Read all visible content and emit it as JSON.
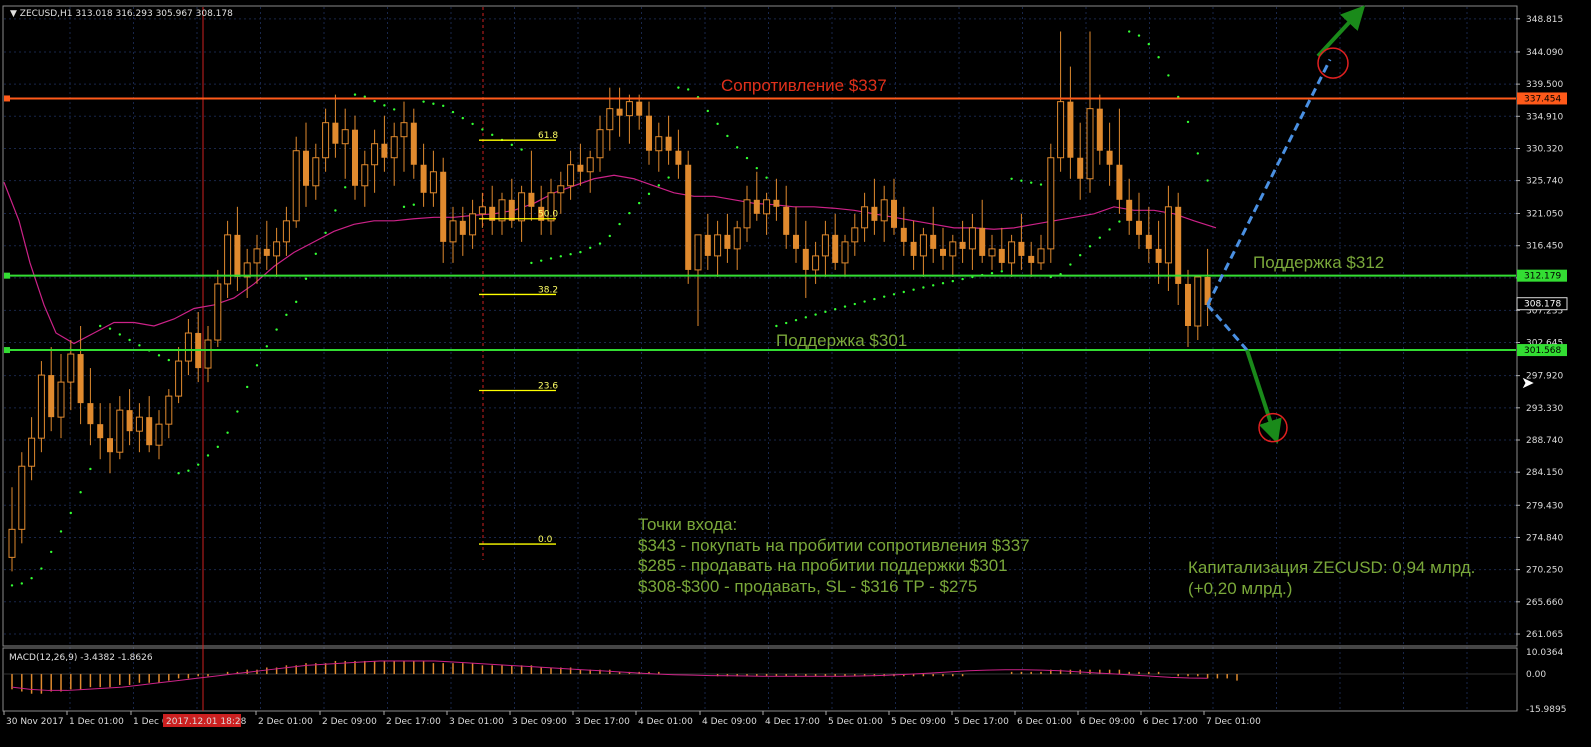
{
  "header": {
    "symbol": "ZECUSD,H1",
    "ohlc": "313.018 316.293 305.967 308.178",
    "macd_label": "MACD(12,26,9) -3.4382 -1.8626"
  },
  "colors": {
    "background": "#000000",
    "grid": "#18264a",
    "frame": "#8a8a8a",
    "candle": "#e08a2e",
    "resistance": "#ff5a1a",
    "support": "#33dd33",
    "ma": "#cc2288",
    "psar": "#33ff33",
    "fib": "#ffff00",
    "arrow_dash": "#4a90e2",
    "arrow_green": "#1a8a1a",
    "target_circle": "#e02020",
    "text_green": "#7aa83a",
    "text_red": "#e0301a"
  },
  "annotations": {
    "resistance_label": "Сопротивление $337",
    "support_312_label": "Поддержка $312",
    "support_301_label": "Поддержка $301",
    "entry_title": "Точки входа:",
    "entry_lines": [
      "$343 - покупать на пробитии сопротивления $337",
      "$285 - продавать на пробитии поддержки $301",
      "$308-$300  - продавать, SL - $316 TP - $275"
    ],
    "cap_line1": "Капитализация ZECUSD: 0,94 млрд.",
    "cap_line2": "(+0,20 млрд.)"
  },
  "chart_data": {
    "type": "candlestick",
    "symbol": "ZECUSD",
    "timeframe": "H1",
    "ylim": [
      259.5,
      350.5
    ],
    "y_ticks": [
      348.815,
      344.09,
      339.5,
      334.91,
      330.32,
      325.74,
      321.05,
      316.45,
      311.86,
      307.235,
      302.645,
      297.92,
      293.33,
      288.74,
      284.15,
      279.43,
      274.84,
      270.25,
      265.66,
      261.065
    ],
    "price_flags": [
      {
        "label": "337.454",
        "value": 337.454,
        "color": "#ff5a1a"
      },
      {
        "label": "312.179",
        "value": 312.179,
        "color": "#33dd33"
      },
      {
        "label": "308.178",
        "value": 308.178,
        "color": "#000000"
      },
      {
        "label": "301.568",
        "value": 301.568,
        "color": "#33dd33"
      }
    ],
    "x_labels": [
      "30 Nov 2017",
      "1 Dec 01:00",
      "1 Dec 0",
      "2017.12.01 18:28",
      "2 Dec 01:00",
      "2 Dec 09:00",
      "2 Dec 17:00",
      "3 Dec 01:00",
      "3 Dec 09:00",
      "3 Dec 17:00",
      "4 Dec 01:00",
      "4 Dec 09:00",
      "4 Dec 17:00",
      "5 Dec 01:00",
      "5 Dec 09:00",
      "5 Dec 17:00",
      "6 Dec 01:00",
      "6 Dec 09:00",
      "6 Dec 17:00",
      "7 Dec 01:00"
    ],
    "horizontal_levels": [
      {
        "name": "resistance",
        "value": 337.454
      },
      {
        "name": "support_312",
        "value": 312.179
      },
      {
        "name": "support_301",
        "value": 301.568
      }
    ],
    "fib_levels": [
      {
        "label": "61.8",
        "value": 331.5
      },
      {
        "label": "50.0",
        "value": 320.3
      },
      {
        "label": "38.2",
        "value": 309.5
      },
      {
        "label": "23.6",
        "value": 295.8
      },
      {
        "label": "0.0",
        "value": 273.9
      }
    ],
    "candles": [
      {
        "o": 272,
        "h": 282,
        "l": 270,
        "c": 276
      },
      {
        "o": 276,
        "h": 287,
        "l": 274,
        "c": 285
      },
      {
        "o": 285,
        "h": 292,
        "l": 283,
        "c": 289
      },
      {
        "o": 289,
        "h": 300,
        "l": 287,
        "c": 298
      },
      {
        "o": 298,
        "h": 302,
        "l": 290,
        "c": 292
      },
      {
        "o": 292,
        "h": 301,
        "l": 289,
        "c": 297
      },
      {
        "o": 297,
        "h": 303,
        "l": 293,
        "c": 301
      },
      {
        "o": 301,
        "h": 305,
        "l": 291,
        "c": 294
      },
      {
        "o": 294,
        "h": 299,
        "l": 288,
        "c": 291
      },
      {
        "o": 291,
        "h": 294,
        "l": 286,
        "c": 289
      },
      {
        "o": 289,
        "h": 294,
        "l": 284,
        "c": 287
      },
      {
        "o": 287,
        "h": 295,
        "l": 286,
        "c": 293
      },
      {
        "o": 293,
        "h": 296,
        "l": 288,
        "c": 290
      },
      {
        "o": 290,
        "h": 294,
        "l": 287,
        "c": 292
      },
      {
        "o": 292,
        "h": 295,
        "l": 287,
        "c": 288
      },
      {
        "o": 288,
        "h": 293,
        "l": 286,
        "c": 291
      },
      {
        "o": 291,
        "h": 296,
        "l": 289,
        "c": 295
      },
      {
        "o": 295,
        "h": 302,
        "l": 294,
        "c": 300
      },
      {
        "o": 300,
        "h": 306,
        "l": 298,
        "c": 304
      },
      {
        "o": 304,
        "h": 307,
        "l": 297,
        "c": 299
      },
      {
        "o": 299,
        "h": 305,
        "l": 297,
        "c": 303
      },
      {
        "o": 303,
        "h": 313,
        "l": 302,
        "c": 311
      },
      {
        "o": 311,
        "h": 320,
        "l": 309,
        "c": 318
      },
      {
        "o": 318,
        "h": 322,
        "l": 310,
        "c": 312
      },
      {
        "o": 312,
        "h": 316,
        "l": 309,
        "c": 314
      },
      {
        "o": 314,
        "h": 318,
        "l": 311,
        "c": 316
      },
      {
        "o": 316,
        "h": 320,
        "l": 313,
        "c": 315
      },
      {
        "o": 315,
        "h": 319,
        "l": 312,
        "c": 317
      },
      {
        "o": 317,
        "h": 322,
        "l": 315,
        "c": 320
      },
      {
        "o": 320,
        "h": 332,
        "l": 319,
        "c": 330
      },
      {
        "o": 330,
        "h": 334,
        "l": 322,
        "c": 325
      },
      {
        "o": 325,
        "h": 331,
        "l": 323,
        "c": 329
      },
      {
        "o": 329,
        "h": 336,
        "l": 327,
        "c": 334
      },
      {
        "o": 334,
        "h": 338,
        "l": 329,
        "c": 331
      },
      {
        "o": 331,
        "h": 336,
        "l": 326,
        "c": 333
      },
      {
        "o": 333,
        "h": 335,
        "l": 323,
        "c": 325
      },
      {
        "o": 325,
        "h": 330,
        "l": 322,
        "c": 328
      },
      {
        "o": 328,
        "h": 333,
        "l": 324,
        "c": 331
      },
      {
        "o": 331,
        "h": 335,
        "l": 327,
        "c": 329
      },
      {
        "o": 329,
        "h": 334,
        "l": 325,
        "c": 332
      },
      {
        "o": 332,
        "h": 337,
        "l": 327,
        "c": 334
      },
      {
        "o": 334,
        "h": 336,
        "l": 326,
        "c": 328
      },
      {
        "o": 328,
        "h": 331,
        "l": 322,
        "c": 324
      },
      {
        "o": 324,
        "h": 330,
        "l": 322,
        "c": 327
      },
      {
        "o": 327,
        "h": 329,
        "l": 314,
        "c": 317
      },
      {
        "o": 317,
        "h": 322,
        "l": 314,
        "c": 320
      },
      {
        "o": 320,
        "h": 322,
        "l": 315,
        "c": 318
      },
      {
        "o": 318,
        "h": 323,
        "l": 316,
        "c": 321
      },
      {
        "o": 321,
        "h": 324,
        "l": 319,
        "c": 322
      },
      {
        "o": 322,
        "h": 325,
        "l": 318,
        "c": 320
      },
      {
        "o": 320,
        "h": 324,
        "l": 318,
        "c": 323
      },
      {
        "o": 323,
        "h": 326,
        "l": 319,
        "c": 320
      },
      {
        "o": 320,
        "h": 325,
        "l": 317,
        "c": 324
      },
      {
        "o": 324,
        "h": 330,
        "l": 320,
        "c": 322
      },
      {
        "o": 322,
        "h": 325,
        "l": 318,
        "c": 320
      },
      {
        "o": 320,
        "h": 326,
        "l": 318,
        "c": 324
      },
      {
        "o": 324,
        "h": 327,
        "l": 321,
        "c": 325
      },
      {
        "o": 325,
        "h": 330,
        "l": 323,
        "c": 328
      },
      {
        "o": 328,
        "h": 331,
        "l": 325,
        "c": 327
      },
      {
        "o": 327,
        "h": 330,
        "l": 324,
        "c": 329
      },
      {
        "o": 329,
        "h": 335,
        "l": 327,
        "c": 333
      },
      {
        "o": 333,
        "h": 339,
        "l": 330,
        "c": 336
      },
      {
        "o": 336,
        "h": 339,
        "l": 332,
        "c": 335
      },
      {
        "o": 335,
        "h": 338,
        "l": 331,
        "c": 337
      },
      {
        "o": 337,
        "h": 338,
        "l": 333,
        "c": 335
      },
      {
        "o": 335,
        "h": 337,
        "l": 328,
        "c": 330
      },
      {
        "o": 330,
        "h": 334,
        "l": 327,
        "c": 332
      },
      {
        "o": 332,
        "h": 335,
        "l": 328,
        "c": 330
      },
      {
        "o": 330,
        "h": 333,
        "l": 326,
        "c": 328
      },
      {
        "o": 328,
        "h": 330,
        "l": 311,
        "c": 313
      },
      {
        "o": 313,
        "h": 318,
        "l": 305,
        "c": 318
      },
      {
        "o": 318,
        "h": 321,
        "l": 313,
        "c": 315
      },
      {
        "o": 315,
        "h": 320,
        "l": 312,
        "c": 318
      },
      {
        "o": 318,
        "h": 321,
        "l": 314,
        "c": 316
      },
      {
        "o": 316,
        "h": 320,
        "l": 313,
        "c": 319
      },
      {
        "o": 319,
        "h": 325,
        "l": 317,
        "c": 323
      },
      {
        "o": 323,
        "h": 327,
        "l": 320,
        "c": 321
      },
      {
        "o": 321,
        "h": 324,
        "l": 318,
        "c": 323
      },
      {
        "o": 323,
        "h": 326,
        "l": 320,
        "c": 322
      },
      {
        "o": 322,
        "h": 325,
        "l": 316,
        "c": 318
      },
      {
        "o": 318,
        "h": 322,
        "l": 314,
        "c": 316
      },
      {
        "o": 316,
        "h": 320,
        "l": 309,
        "c": 313
      },
      {
        "o": 313,
        "h": 317,
        "l": 311,
        "c": 315
      },
      {
        "o": 315,
        "h": 320,
        "l": 312,
        "c": 318
      },
      {
        "o": 318,
        "h": 321,
        "l": 313,
        "c": 314
      },
      {
        "o": 314,
        "h": 318,
        "l": 312,
        "c": 317
      },
      {
        "o": 317,
        "h": 321,
        "l": 315,
        "c": 319
      },
      {
        "o": 319,
        "h": 324,
        "l": 317,
        "c": 322
      },
      {
        "o": 322,
        "h": 326,
        "l": 318,
        "c": 320
      },
      {
        "o": 320,
        "h": 325,
        "l": 317,
        "c": 323
      },
      {
        "o": 323,
        "h": 326,
        "l": 318,
        "c": 319
      },
      {
        "o": 319,
        "h": 322,
        "l": 315,
        "c": 317
      },
      {
        "o": 317,
        "h": 320,
        "l": 313,
        "c": 315
      },
      {
        "o": 315,
        "h": 319,
        "l": 312,
        "c": 318
      },
      {
        "o": 318,
        "h": 322,
        "l": 314,
        "c": 316
      },
      {
        "o": 316,
        "h": 319,
        "l": 313,
        "c": 315
      },
      {
        "o": 315,
        "h": 318,
        "l": 312,
        "c": 317
      },
      {
        "o": 317,
        "h": 320,
        "l": 314,
        "c": 316
      },
      {
        "o": 316,
        "h": 321,
        "l": 313,
        "c": 319
      },
      {
        "o": 319,
        "h": 323,
        "l": 314,
        "c": 315
      },
      {
        "o": 315,
        "h": 318,
        "l": 313,
        "c": 316
      },
      {
        "o": 316,
        "h": 319,
        "l": 313,
        "c": 314
      },
      {
        "o": 314,
        "h": 318,
        "l": 312,
        "c": 317
      },
      {
        "o": 317,
        "h": 321,
        "l": 313,
        "c": 315
      },
      {
        "o": 315,
        "h": 317,
        "l": 312,
        "c": 314
      },
      {
        "o": 314,
        "h": 318,
        "l": 313,
        "c": 316
      },
      {
        "o": 316,
        "h": 331,
        "l": 314,
        "c": 329
      },
      {
        "o": 329,
        "h": 347,
        "l": 327,
        "c": 337
      },
      {
        "o": 337,
        "h": 342,
        "l": 326,
        "c": 329
      },
      {
        "o": 329,
        "h": 334,
        "l": 323,
        "c": 326
      },
      {
        "o": 326,
        "h": 347,
        "l": 324,
        "c": 336
      },
      {
        "o": 336,
        "h": 338,
        "l": 328,
        "c": 330
      },
      {
        "o": 330,
        "h": 334,
        "l": 325,
        "c": 328
      },
      {
        "o": 328,
        "h": 336,
        "l": 321,
        "c": 323
      },
      {
        "o": 323,
        "h": 326,
        "l": 318,
        "c": 320
      },
      {
        "o": 320,
        "h": 324,
        "l": 316,
        "c": 318
      },
      {
        "o": 318,
        "h": 322,
        "l": 314,
        "c": 316
      },
      {
        "o": 316,
        "h": 320,
        "l": 311,
        "c": 314
      },
      {
        "o": 314,
        "h": 325,
        "l": 310,
        "c": 322
      },
      {
        "o": 322,
        "h": 324,
        "l": 308,
        "c": 311
      },
      {
        "o": 311,
        "h": 313,
        "l": 302,
        "c": 305
      },
      {
        "o": 305,
        "h": 312,
        "l": 303,
        "c": 312
      },
      {
        "o": 312,
        "h": 316,
        "l": 305,
        "c": 308
      }
    ],
    "moving_average": [
      {
        "x": 0,
        "value": 325.5
      },
      {
        "x": 15,
        "value": 320
      },
      {
        "x": 26,
        "value": 314
      },
      {
        "x": 40,
        "value": 308
      },
      {
        "x": 52,
        "value": 304
      },
      {
        "x": 70,
        "value": 302.5
      },
      {
        "x": 90,
        "value": 304
      },
      {
        "x": 110,
        "value": 305.5
      },
      {
        "x": 130,
        "value": 305.5
      },
      {
        "x": 150,
        "value": 305
      },
      {
        "x": 170,
        "value": 306
      },
      {
        "x": 190,
        "value": 307.5
      },
      {
        "x": 210,
        "value": 308
      },
      {
        "x": 230,
        "value": 309
      },
      {
        "x": 250,
        "value": 311
      },
      {
        "x": 270,
        "value": 313.5
      },
      {
        "x": 290,
        "value": 315.5
      },
      {
        "x": 310,
        "value": 317
      },
      {
        "x": 330,
        "value": 318.5
      },
      {
        "x": 350,
        "value": 319.5
      },
      {
        "x": 370,
        "value": 320
      },
      {
        "x": 390,
        "value": 320
      },
      {
        "x": 410,
        "value": 320.3
      },
      {
        "x": 430,
        "value": 320.5
      },
      {
        "x": 450,
        "value": 320.5
      },
      {
        "x": 470,
        "value": 320.8
      },
      {
        "x": 490,
        "value": 321
      },
      {
        "x": 510,
        "value": 321.5
      },
      {
        "x": 530,
        "value": 322.5
      },
      {
        "x": 550,
        "value": 324
      },
      {
        "x": 570,
        "value": 325
      },
      {
        "x": 590,
        "value": 326
      },
      {
        "x": 610,
        "value": 326.5
      },
      {
        "x": 630,
        "value": 326
      },
      {
        "x": 650,
        "value": 325
      },
      {
        "x": 670,
        "value": 324
      },
      {
        "x": 690,
        "value": 323.5
      },
      {
        "x": 710,
        "value": 323.5
      },
      {
        "x": 730,
        "value": 323
      },
      {
        "x": 750,
        "value": 322.5
      },
      {
        "x": 770,
        "value": 322.3
      },
      {
        "x": 790,
        "value": 322
      },
      {
        "x": 810,
        "value": 322
      },
      {
        "x": 830,
        "value": 321.8
      },
      {
        "x": 850,
        "value": 321.5
      },
      {
        "x": 870,
        "value": 321
      },
      {
        "x": 890,
        "value": 320.5
      },
      {
        "x": 910,
        "value": 320
      },
      {
        "x": 930,
        "value": 319.5
      },
      {
        "x": 950,
        "value": 319
      },
      {
        "x": 970,
        "value": 319
      },
      {
        "x": 990,
        "value": 318.8
      },
      {
        "x": 1010,
        "value": 319
      },
      {
        "x": 1030,
        "value": 319.5
      },
      {
        "x": 1050,
        "value": 320
      },
      {
        "x": 1070,
        "value": 320.5
      },
      {
        "x": 1090,
        "value": 321
      },
      {
        "x": 1110,
        "value": 322
      },
      {
        "x": 1130,
        "value": 321.5
      },
      {
        "x": 1150,
        "value": 321.5
      },
      {
        "x": 1170,
        "value": 321
      },
      {
        "x": 1190,
        "value": 320
      },
      {
        "x": 1212,
        "value": 319
      }
    ],
    "macd_ylim": [
      -16.0,
      10.1
    ],
    "macd_ticks": [
      10.0364,
      0.0,
      -15.9895
    ],
    "macd_histogram": [
      -7,
      -8,
      -9,
      -9,
      -8,
      -8,
      -7,
      -7,
      -6,
      -6,
      -6,
      -5,
      -5,
      -4,
      -4,
      -4,
      -3,
      -2,
      -2,
      -1,
      -1,
      0,
      1,
      1,
      2,
      2,
      3,
      3,
      4,
      4,
      5,
      5,
      5,
      6,
      6,
      6,
      6,
      6,
      6,
      6,
      6,
      6,
      6,
      5,
      5,
      5,
      5,
      5,
      4,
      4,
      4,
      4,
      4,
      4,
      3,
      3,
      3,
      3,
      2,
      2,
      2,
      2,
      1,
      1,
      1,
      1,
      1,
      0,
      0,
      0,
      0,
      0,
      -1,
      -1,
      -1,
      -1,
      -1,
      -1,
      -1,
      -1,
      -1,
      -1,
      -1,
      -1,
      -1,
      -1,
      -1,
      -1,
      -1,
      -1,
      -1,
      -1,
      -1,
      -1,
      -1,
      -1,
      -1,
      -1,
      0,
      0,
      0,
      0,
      1,
      1,
      1,
      1,
      2,
      2,
      2,
      2,
      2,
      2,
      2,
      2,
      1,
      1,
      1,
      1,
      0,
      -1,
      -1,
      -1,
      -2,
      -2,
      -2,
      -3
    ],
    "macd_signal": [
      -6,
      -7,
      -7.5,
      -7.5,
      -7,
      -6.5,
      -6,
      -5,
      -4,
      -3,
      -2,
      -1,
      0,
      1,
      2,
      3,
      4,
      4.5,
      5,
      5.5,
      6,
      6,
      6,
      6,
      5.5,
      5,
      4.5,
      4,
      3.5,
      3,
      2.5,
      2,
      1.5,
      1,
      0.5,
      0,
      -0.3,
      -0.5,
      -0.7,
      -0.8,
      -0.9,
      -1,
      -1,
      -1,
      -1,
      -1,
      -0.9,
      -0.7,
      -0.4,
      0,
      0.5,
      1,
      1.5,
      1.8,
      2,
      2,
      1.8,
      1.5,
      1,
      0.5,
      0,
      -0.5,
      -1,
      -1.5,
      -1.8,
      -1.9
    ]
  }
}
